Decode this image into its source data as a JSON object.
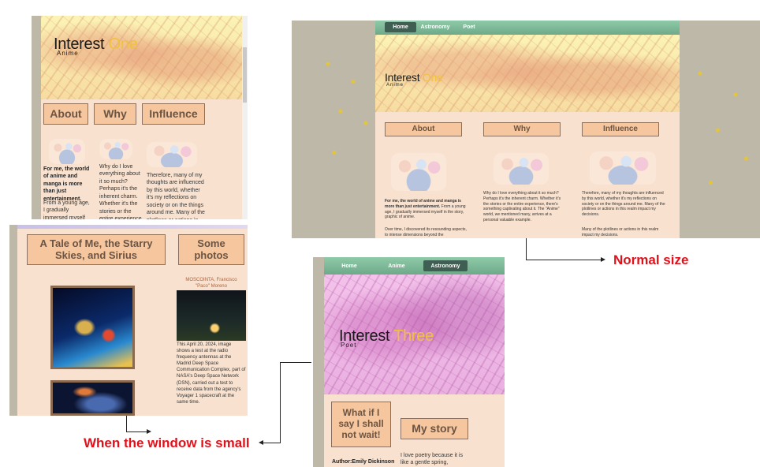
{
  "captions": {
    "normal": "Normal size",
    "small": "When the window is small"
  },
  "site": {
    "title_main": "Interest ",
    "title_one": "One",
    "title_three": "Three",
    "sub_anime": "Anime",
    "sub_poet": "Poet"
  },
  "nav": {
    "normal": [
      "Home",
      "Astronomy",
      "Poet"
    ],
    "small": [
      "Home",
      "Anime",
      "Astronomy"
    ]
  },
  "buttons": {
    "about": "About",
    "why": "Why",
    "influence": "Influence",
    "tale": "A Tale of Me, the Starry Skies, and Sirius",
    "photos": "Some photos",
    "what_if": "What if I say I shall not wait!",
    "my_story": "My story"
  },
  "anime_text": {
    "col1_bold": "For me, the world of anime and manga is more than just entertainment.",
    "col1_normal_long": "From a young age, I gradually immersed myself in the story, graphic of anime.",
    "col1_normal_short": "From a young age, I gradually immersed myself in",
    "col1_extra": "Over time, I discovered its resounding aspects, to intense dimensions beyond the",
    "col2_normal": "Why do I love everything about it so much? Perhaps it's the inherent charm. Whether it's the stories or the entire experience, there's something captivating about it. The \"Anime\" world, we mentioned many, arrives at a personal valuable example.",
    "col2_small": "Why do I love everything about it so much? Perhaps it's the inherent charm. Whether it's the stories or the entire experience, there's something",
    "col3_normal": "Therefore, many of my thoughts are influenced by this world, whether it's my reflections on society or on the things around me. Many of the plotlines or actions in this realm impact my decisions.",
    "col3_extra": "Many of the plotlines or actions in this realm impact my decisions.",
    "col3_small": "Therefore, many of my thoughts are influenced by this world, whether it's my reflections on society or on the things around me. Many of the plotlines or actions in this realm impact my decisions."
  },
  "astronomy": {
    "photo_credit": "MOSCOINTA, Francisco \"Paco\" Moreno",
    "photo_desc": "This April 20, 2024, image shows a test at the radio frequency antennas at the Madrid Deep Space Communication Complex, part of NASA's Deep Space Network (DSN), carried out a test to receive data from the agency's Voyager 1 spacecraft at the same time."
  },
  "poet": {
    "author": "Author:Emily Dickinson",
    "story_text": "I love poetry because it is like a gentle spring,"
  }
}
